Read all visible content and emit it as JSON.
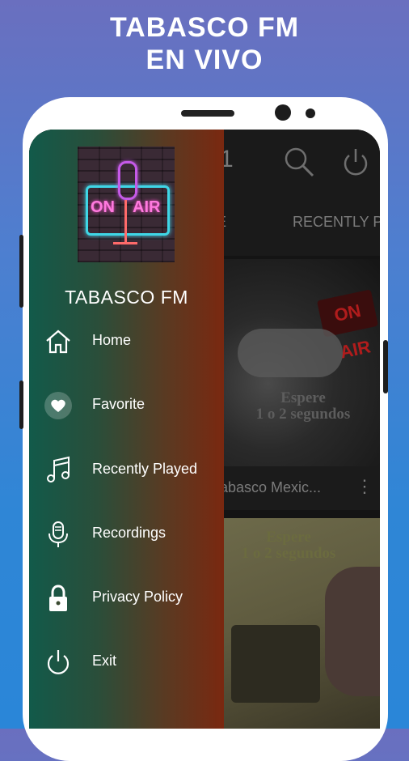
{
  "promo": {
    "line1": "TABASCO FM",
    "line2": "EN VIVO"
  },
  "app": {
    "appbar_title_fragment": "1",
    "tabs": [
      "E",
      "RECENTLY PL"
    ],
    "station_caption": "abasco Mexic...",
    "overlay_1": [
      "Espere",
      "1 o 2 segundos"
    ],
    "overlay_2": [
      "Espere",
      "1 o 2 segundos"
    ],
    "onair_sign": "ON AIR"
  },
  "drawer": {
    "logo": {
      "on": "ON",
      "air": "AIR"
    },
    "title": "TABASCO FM",
    "items": [
      {
        "label": "Home",
        "icon": "home-icon"
      },
      {
        "label": "Favorite",
        "icon": "heart-icon"
      },
      {
        "label": "Recently Played",
        "icon": "music-note-icon"
      },
      {
        "label": "Recordings",
        "icon": "microphone-icon"
      },
      {
        "label": "Privacy Policy",
        "icon": "lock-icon"
      },
      {
        "label": "Exit",
        "icon": "power-icon"
      }
    ]
  },
  "colors": {
    "drawer_start": "#125a4a",
    "drawer_end": "#7a2810",
    "background": "#2a86d8"
  }
}
